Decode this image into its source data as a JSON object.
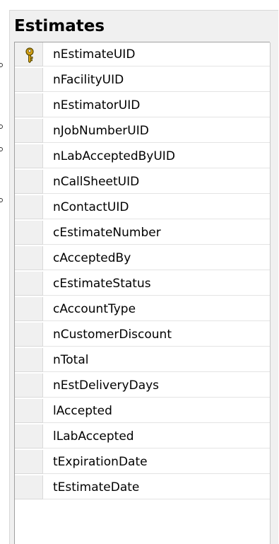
{
  "table": {
    "title": "Estimates",
    "columns": [
      {
        "name": "nEstimateUID",
        "primary_key": true,
        "icon": "primary-key-icon"
      },
      {
        "name": "nFacilityUID"
      },
      {
        "name": "nEstimatorUID"
      },
      {
        "name": "nJobNumberUID"
      },
      {
        "name": "nLabAcceptedByUID"
      },
      {
        "name": "nCallSheetUID"
      },
      {
        "name": "nContactUID"
      },
      {
        "name": "cEstimateNumber"
      },
      {
        "name": "cAcceptedBy"
      },
      {
        "name": "cEstimateStatus"
      },
      {
        "name": "cAccountType"
      },
      {
        "name": "nCustomerDiscount"
      },
      {
        "name": "nTotal"
      },
      {
        "name": "nEstDeliveryDays"
      },
      {
        "name": "lAccepted"
      },
      {
        "name": "lLabAccepted"
      },
      {
        "name": "tExpirationDate"
      },
      {
        "name": "tEstimateDate"
      }
    ]
  },
  "colors": {
    "panel_background": "#f0f0f0",
    "grid_background": "#ffffff",
    "key_icon": "#d4a017"
  }
}
